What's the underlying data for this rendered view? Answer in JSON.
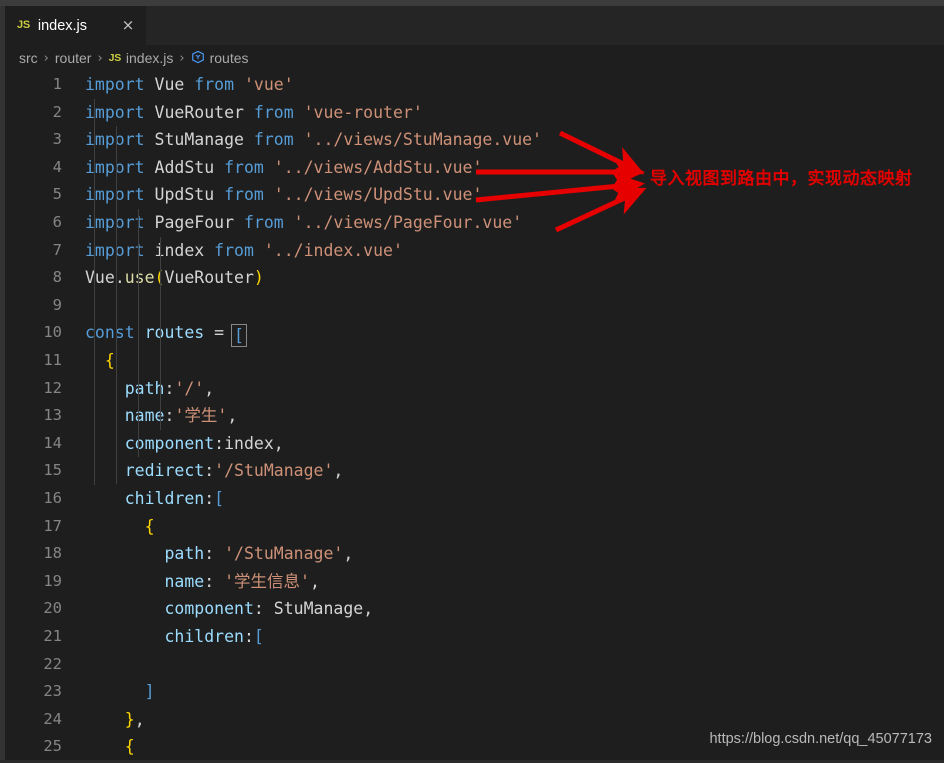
{
  "window": {
    "title_strip_color": "#3c3c3c",
    "editor_background": "#1e1e1e",
    "tabbar_background": "#252526"
  },
  "tab": {
    "icon": "JS",
    "icon_name": "js-file-icon",
    "label": "index.js",
    "close": "×"
  },
  "breadcrumb": {
    "items": [
      {
        "label": "src",
        "icon": null
      },
      {
        "label": "router",
        "icon": null
      },
      {
        "label": "index.js",
        "icon": "JS"
      },
      {
        "label": "routes",
        "icon": "symbol-variable"
      }
    ],
    "separator": "›"
  },
  "editor": {
    "language": "javascript",
    "first_line": 1,
    "last_line": 25,
    "line_height": 27.6,
    "lines": [
      {
        "n": 1,
        "text": "import Vue from 'vue'"
      },
      {
        "n": 2,
        "text": "import VueRouter from 'vue-router'"
      },
      {
        "n": 3,
        "text": "import StuManage from '../views/StuManage.vue'"
      },
      {
        "n": 4,
        "text": "import AddStu from '../views/AddStu.vue'"
      },
      {
        "n": 5,
        "text": "import UpdStu from '../views/UpdStu.vue'"
      },
      {
        "n": 6,
        "text": "import PageFour from '../views/PageFour.vue'"
      },
      {
        "n": 7,
        "text": "import index from '../index.vue'"
      },
      {
        "n": 8,
        "text": "Vue.use(VueRouter)"
      },
      {
        "n": 9,
        "text": ""
      },
      {
        "n": 10,
        "text": "const routes = ["
      },
      {
        "n": 11,
        "text": "  {"
      },
      {
        "n": 12,
        "text": "    path:'/',"
      },
      {
        "n": 13,
        "text": "    name:'学生',"
      },
      {
        "n": 14,
        "text": "    component:index,"
      },
      {
        "n": 15,
        "text": "    redirect:'/StuManage',"
      },
      {
        "n": 16,
        "text": "    children:["
      },
      {
        "n": 17,
        "text": "      {"
      },
      {
        "n": 18,
        "text": "        path: '/StuManage',"
      },
      {
        "n": 19,
        "text": "        name: '学生信息',"
      },
      {
        "n": 20,
        "text": "        component: StuManage,"
      },
      {
        "n": 21,
        "text": "        children:["
      },
      {
        "n": 22,
        "text": ""
      },
      {
        "n": 23,
        "text": "      ]"
      },
      {
        "n": 24,
        "text": "    },"
      },
      {
        "n": 25,
        "text": "    {"
      }
    ],
    "colors": {
      "keyword": "#569cd6",
      "string": "#ce9178",
      "identifier": "#d4d4d4",
      "variable": "#9cdcfe",
      "function": "#dcdcaa",
      "brace": "#ffd700",
      "line_number": "#858585",
      "indent_guide": "#404040"
    }
  },
  "annotation": {
    "text": "导入视图到路由中，实现动态映射",
    "color": "#e00000",
    "arrow_count": 4
  },
  "watermark": {
    "text": "https://blog.csdn.net/qq_45077173",
    "color": "#b9b9b9"
  }
}
